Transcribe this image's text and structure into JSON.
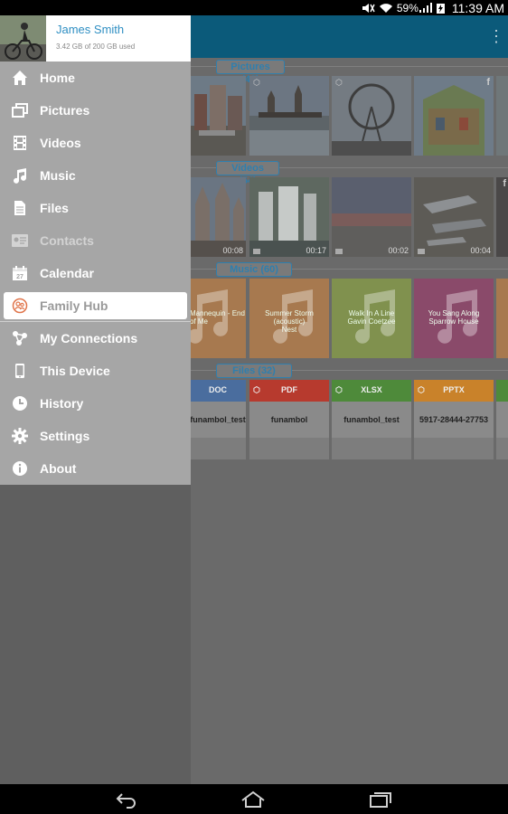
{
  "status_bar": {
    "battery": "59%",
    "time": "11:39 AM",
    "icons": [
      "mute-icon",
      "wifi-icon",
      "signal-icon",
      "battery-charging-icon"
    ]
  },
  "profile": {
    "name": "James Smith",
    "usage": "3.42 GB of 200 GB used"
  },
  "menu": {
    "home": "Home",
    "pictures": "Pictures",
    "videos": "Videos",
    "music": "Music",
    "files": "Files",
    "contacts": "Contacts",
    "calendar": "Calendar",
    "family_hub": "Family Hub",
    "my_connections": "My Connections",
    "this_device": "This Device",
    "history": "History",
    "settings": "Settings",
    "about": "About"
  },
  "sections": {
    "pictures": "Pictures (46)",
    "videos": "Videos (54)",
    "music": "Music (60)",
    "files": "Files (32)"
  },
  "videos": {
    "durations": [
      "00:08",
      "00:17",
      "00:02",
      "00:04"
    ]
  },
  "music_tiles": [
    {
      "title": "Mannequin - End of Me",
      "artist": ""
    },
    {
      "title": "Summer Storm (acoustic)",
      "artist": "Nest"
    },
    {
      "title": "Walk In A Line",
      "artist": "Gavin Coetzee"
    },
    {
      "title": "You Sang Along",
      "artist": "Sparrow House"
    }
  ],
  "files": [
    {
      "type": "DOC",
      "name": "funambol_test",
      "color": "#4a6d9e"
    },
    {
      "type": "PDF",
      "name": "funambol",
      "color": "#b73a2e"
    },
    {
      "type": "XLSX",
      "name": "funambol_test",
      "color": "#4e8a3a"
    },
    {
      "type": "PPTX",
      "name": "5917-28444-27753",
      "color": "#c9822a"
    }
  ],
  "colors": {
    "accent": "#2f8fc3",
    "appbar": "#0b5a7a",
    "drawer_bg": "#a6a6a6"
  }
}
